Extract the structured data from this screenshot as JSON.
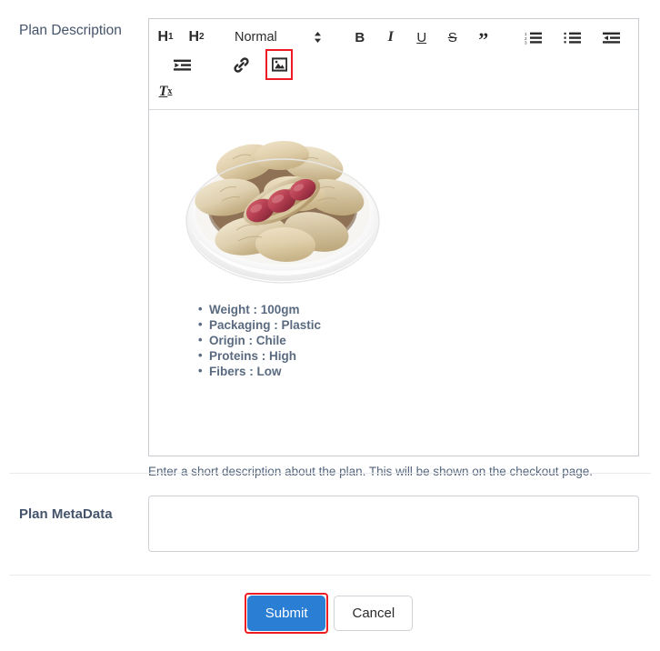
{
  "form": {
    "description_row": {
      "label": "Plan Description",
      "help_text": "Enter a short description about the plan. This will be shown on the checkout page."
    },
    "metadata_row": {
      "label": "Plan MetaData",
      "value": "",
      "placeholder": ""
    }
  },
  "editor": {
    "toolbar": {
      "heading1": "H1",
      "heading1_base": "H",
      "heading1_sub": "1",
      "heading2_base": "H",
      "heading2_sub": "2",
      "block_format": "Normal",
      "bold": "B",
      "italic": "I",
      "underline": "U",
      "strike": "S",
      "blockquote": "”",
      "clear_format_base": "T",
      "clear_format_sub": "x",
      "items": [
        {
          "name": "heading-1-button",
          "label": "H1"
        },
        {
          "name": "heading-2-button",
          "label": "H2"
        },
        {
          "name": "block-format-select",
          "label": "Normal"
        },
        {
          "name": "bold-button",
          "label": "B"
        },
        {
          "name": "italic-button",
          "label": "I"
        },
        {
          "name": "underline-button",
          "label": "U"
        },
        {
          "name": "strikethrough-button",
          "label": "S"
        },
        {
          "name": "blockquote-button",
          "label": "”"
        },
        {
          "name": "ordered-list-button",
          "label": "ordered-list-icon"
        },
        {
          "name": "bullet-list-button",
          "label": "bullet-list-icon"
        },
        {
          "name": "outdent-button",
          "label": "outdent-icon"
        },
        {
          "name": "indent-button",
          "label": "indent-icon"
        },
        {
          "name": "link-button",
          "label": "link-icon"
        },
        {
          "name": "image-button",
          "label": "image-icon"
        },
        {
          "name": "clear-format-button",
          "label": "Tx"
        }
      ],
      "highlighted_item": "image-button"
    },
    "content": {
      "image_alt": "bowl-of-peanuts",
      "bullets": [
        "Weight : 100gm",
        "Packaging : Plastic",
        "Origin : Chile",
        "Proteins : High",
        "Fibers : Low"
      ]
    }
  },
  "actions": {
    "submit_label": "Submit",
    "cancel_label": "Cancel",
    "highlighted_button": "submit-button"
  },
  "colors": {
    "primary": "#2a7fd4",
    "highlight": "#ee1c22",
    "label_text": "#45546b",
    "body_text": "#5a6a80",
    "border": "#c8ccd0"
  }
}
